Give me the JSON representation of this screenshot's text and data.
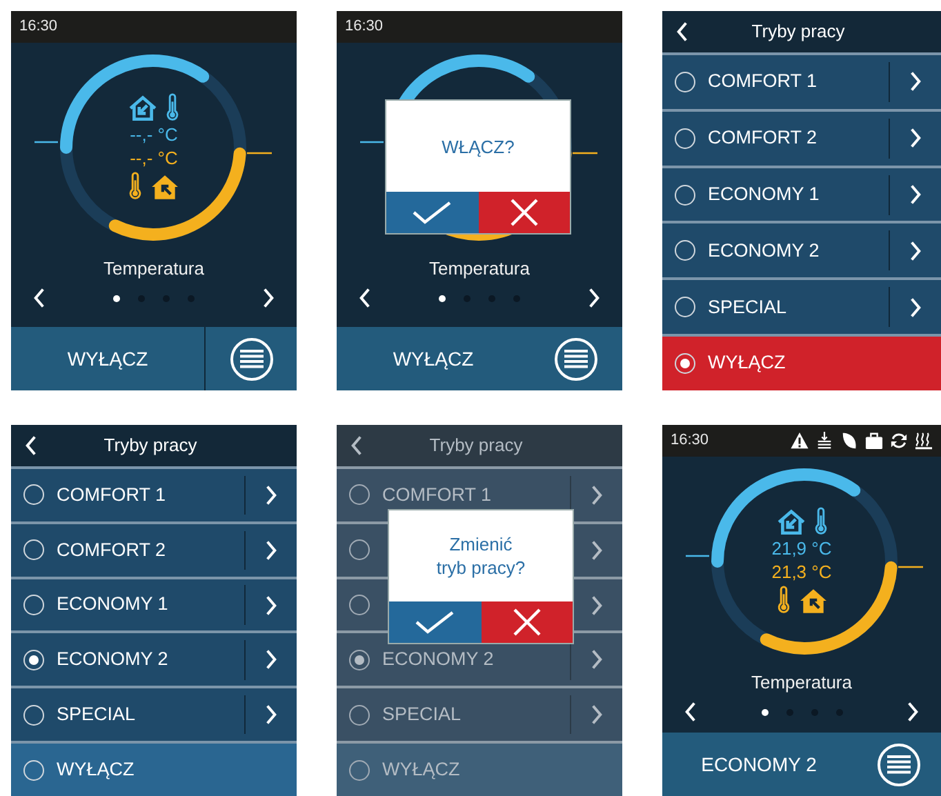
{
  "screens": [
    {
      "kind": "home",
      "status": {
        "time": "16:30",
        "icons_shown": false
      },
      "readings": [
        {
          "kind": "supply",
          "text": "--,- °C"
        },
        {
          "kind": "extract",
          "text": "--,- °C"
        }
      ],
      "page_title": "Temperatura",
      "pages": [
        {
          "selected": true
        },
        {
          "selected": false
        },
        {
          "selected": false
        },
        {
          "selected": false
        }
      ],
      "footer": {
        "label": "WYŁĄCZ",
        "divider": true
      }
    },
    {
      "kind": "home",
      "status": {
        "time": "16:30",
        "icons_shown": false
      },
      "page_title": "Temperatura",
      "pages": [
        {
          "selected": true
        },
        {
          "selected": false
        },
        {
          "selected": false
        },
        {
          "selected": false
        }
      ],
      "footer": {
        "label": "WYŁĄCZ",
        "divider": false
      },
      "dialog": {
        "message": "WŁĄCZ?"
      }
    },
    {
      "kind": "modes",
      "dimmed": false,
      "title": "Tryby pracy",
      "items": [
        {
          "kind": "mode",
          "label": "COMFORT 1",
          "selected": false
        },
        {
          "kind": "mode",
          "label": "COMFORT 2",
          "selected": false
        },
        {
          "kind": "mode",
          "label": "ECONOMY 1",
          "selected": false
        },
        {
          "kind": "mode",
          "label": "ECONOMY 2",
          "selected": false
        },
        {
          "kind": "mode",
          "label": "SPECIAL",
          "selected": false
        },
        {
          "kind": "off",
          "label": "WYŁĄCZ",
          "selected": true
        }
      ]
    },
    {
      "kind": "modes",
      "dimmed": false,
      "title": "Tryby pracy",
      "items": [
        {
          "kind": "mode",
          "label": "COMFORT 1",
          "selected": false
        },
        {
          "kind": "mode",
          "label": "COMFORT 2",
          "selected": false
        },
        {
          "kind": "mode",
          "label": "ECONOMY 1",
          "selected": false
        },
        {
          "kind": "mode",
          "label": "ECONOMY 2",
          "selected": true
        },
        {
          "kind": "mode",
          "label": "SPECIAL",
          "selected": false
        },
        {
          "kind": "off",
          "label": "WYŁĄCZ",
          "selected": false
        }
      ]
    },
    {
      "kind": "modes",
      "dimmed": true,
      "title": "Tryby pracy",
      "items": [
        {
          "kind": "mode",
          "label": "COMFORT 1",
          "selected": false
        },
        {
          "kind": "mode",
          "selected": false
        },
        {
          "kind": "mode",
          "selected": false
        },
        {
          "kind": "mode",
          "label": "ECONOMY 2",
          "selected": true
        },
        {
          "kind": "mode",
          "label": "SPECIAL",
          "selected": false
        },
        {
          "kind": "off",
          "label": "WYŁĄCZ",
          "selected": false
        }
      ],
      "dialog": {
        "message": "Zmienić\ntryb pracy?"
      }
    },
    {
      "kind": "home",
      "status": {
        "time": "16:30",
        "icons_shown": true
      },
      "readings": [
        {
          "kind": "supply",
          "text": "21,9 °C"
        },
        {
          "kind": "extract",
          "text": "21,3 °C"
        }
      ],
      "page_title": "Temperatura",
      "pages": [
        {
          "selected": true
        },
        {
          "selected": false
        },
        {
          "selected": false
        },
        {
          "selected": false
        }
      ],
      "footer": {
        "label": "ECONOMY 2",
        "divider": false
      }
    }
  ]
}
